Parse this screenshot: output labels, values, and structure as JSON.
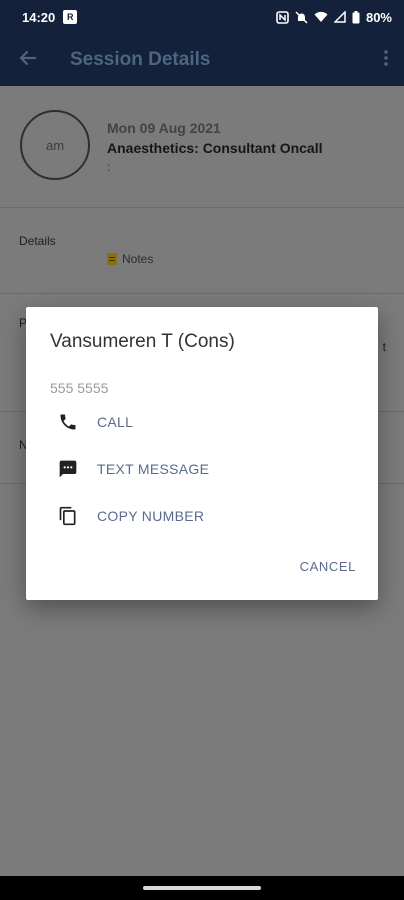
{
  "status_bar": {
    "time": "14:20",
    "badge": "R",
    "battery": "80%"
  },
  "app_bar": {
    "title": "Session Details",
    "back_icon": "arrow-back-icon",
    "menu_icon": "more-vert-icon"
  },
  "session": {
    "avatar_text": "am",
    "date": "Mon 09 Aug 2021",
    "title": "Anaesthetics: Consultant Oncall",
    "subtitle": ":"
  },
  "details": {
    "label": "Details",
    "notes_label": "Notes"
  },
  "rows": {
    "row3_letter": "P",
    "row3_right": "t",
    "row4_letter": "N"
  },
  "dialog": {
    "title": "Vansumeren T (Cons)",
    "number": "555 5555",
    "actions": [
      {
        "label": "CALL",
        "icon": "phone-icon"
      },
      {
        "label": "TEXT MESSAGE",
        "icon": "message-icon"
      },
      {
        "label": "COPY NUMBER",
        "icon": "copy-icon"
      }
    ],
    "cancel_label": "CANCEL"
  },
  "colors": {
    "app_bar": "#13213a",
    "accent_text": "#5b6a8d"
  }
}
